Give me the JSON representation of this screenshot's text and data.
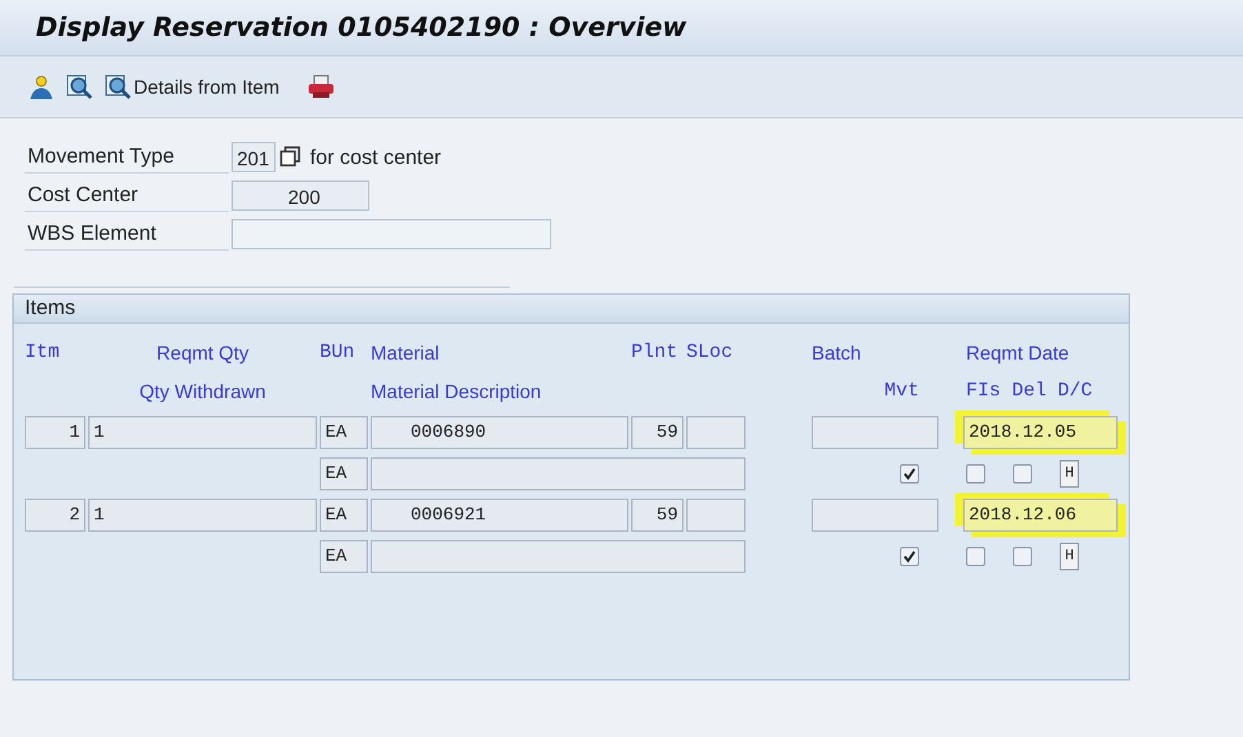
{
  "window": {
    "title": "Display Reservation 0105402190 : Overview"
  },
  "toolbar": {
    "buttons": [
      {
        "kind": "person"
      },
      {
        "kind": "magnifier"
      },
      {
        "kind": "magnifier",
        "label": "Details from Item"
      },
      {
        "kind": "printer"
      }
    ]
  },
  "header_fields": [
    {
      "label": "Movement Type",
      "value": "201",
      "kind": "lookup",
      "note": "for cost center"
    },
    {
      "label": "Cost Center",
      "value": "200",
      "kind": "plain"
    },
    {
      "label": "WBS Element",
      "kind": "plain"
    }
  ],
  "items": {
    "title": "Items",
    "columns_1": [
      "Itm",
      "Reqmt Qty",
      "BUn",
      "Material",
      "Plnt",
      "SLoc",
      "Batch",
      "Reqmt Date"
    ],
    "columns_2": [
      "Qty Withdrawn",
      "Material Description",
      "Mvt",
      "FIs",
      "Del",
      "D/C"
    ],
    "rows": [
      {
        "item": "1",
        "reqmt_qty": "1",
        "unit": "EA",
        "material": "0006890",
        "plant": "59",
        "reqmt_date": "2018.12.05",
        "date_highlighted": true,
        "unit_2": "EA",
        "mvt": true,
        "final_issue": false,
        "deleted": false,
        "debit_credit": "H"
      },
      {
        "item": "2",
        "reqmt_qty": "1",
        "unit": "EA",
        "material": "0006921",
        "plant": "59",
        "reqmt_date": "2018.12.06",
        "date_highlighted": true,
        "unit_2": "EA",
        "mvt": true,
        "final_issue": false,
        "deleted": false,
        "debit_credit": "H"
      }
    ]
  }
}
